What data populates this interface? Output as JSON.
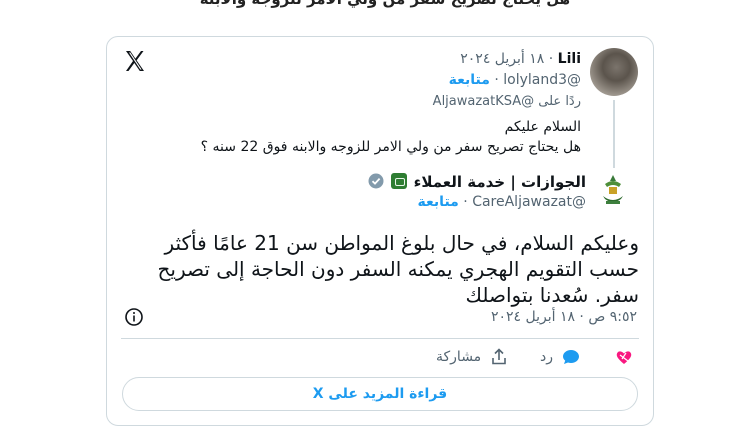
{
  "header_clip": "هل يحتاج تصريح سفر من ولي الامر للزوجه والابنه",
  "original_tweet": {
    "author_name": "Lili",
    "date": "· ١٨ أبريل ٢٠٢٤",
    "handle": "@lolyland3",
    "follow_label": "متابعة",
    "separator": "·",
    "reply_to": "ردًا على @AljawazatKSA",
    "text_line1": "السلام عليكم",
    "text_line2": "هل يحتاج تصريح سفر من ولي الامر للزوجه والابنه فوق 22 سنه ؟"
  },
  "reply_tweet": {
    "author_name": "الجوازات | خدمة العملاء",
    "handle": "@CareAljawazat",
    "follow_label": "متابعة",
    "separator": "·",
    "text": "وعليكم السلام، في حال بلوغ المواطن سن 21 عامًا فأكثر حسب التقويم الهجري يمكنه السفر دون الحاجة إلى تصريح سفر. سُعدنا بتواصلك",
    "timestamp": "٩:٥٢ ص · ١٨ أبريل ٢٠٢٤"
  },
  "actions": {
    "reply_label": "رد",
    "share_label": "مشاركة"
  },
  "read_more_label": "قراءة المزيد على X",
  "colors": {
    "accent": "#1d9bf0",
    "heart": "#f91880",
    "muted": "#536471",
    "border": "#cfd9de"
  },
  "icons": [
    "x-logo-icon",
    "info-icon",
    "heart-icon",
    "reply-bubble-icon",
    "share-icon",
    "verified-badge-icon",
    "flag-icon"
  ]
}
